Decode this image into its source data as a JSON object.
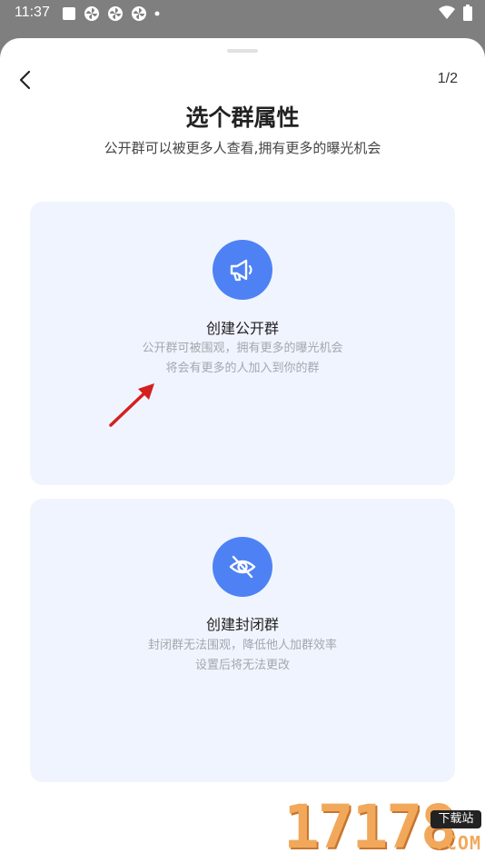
{
  "status_bar": {
    "time": "11:37",
    "icons": [
      "app-square-icon",
      "pinwheel-icon",
      "pinwheel-icon",
      "pinwheel-icon",
      "dot-icon",
      "wifi-icon",
      "battery-icon"
    ]
  },
  "header": {
    "page_indicator": "1/2",
    "title": "选个群属性",
    "subtitle": "公开群可以被更多人查看,拥有更多的曝光机会"
  },
  "options": [
    {
      "title": "创建公开群",
      "desc_line1": "公开群可被围观，拥有更多的曝光机会",
      "desc_line2": "将会有更多的人加入到你的群",
      "icon": "megaphone-icon"
    },
    {
      "title": "创建封闭群",
      "desc_line1": "封闭群无法围观，降低他人加群效率",
      "desc_line2": "设置后将无法更改",
      "icon": "eye-off-icon"
    }
  ],
  "colors": {
    "accent": "#4e82f4",
    "card_bg": "#f0f4fe",
    "annotation_arrow": "#d42020"
  },
  "watermark": {
    "digits": "17178",
    "badge": "下载站",
    "suffix": ".COM"
  }
}
